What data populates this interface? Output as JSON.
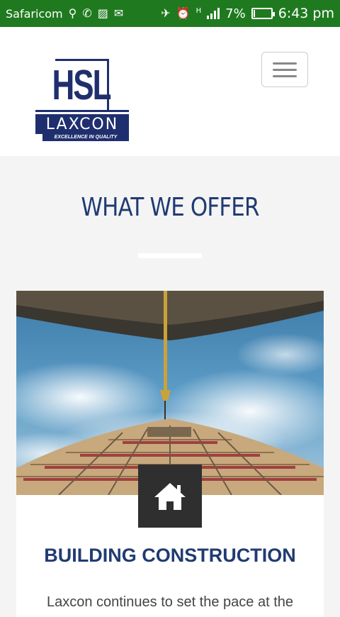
{
  "status_bar": {
    "carrier": "Safaricom",
    "network_type": "H",
    "battery": "7%",
    "battery_level": 0.07,
    "time": "6:43 pm"
  },
  "header": {
    "logo": {
      "mark": "HSL",
      "name": "LAXCON",
      "tagline": "EXCELLENCE IN QUALITY"
    },
    "menu_icon": "hamburger-icon"
  },
  "section": {
    "title": "WHAT WE OFFER"
  },
  "card": {
    "icon": "home-icon",
    "title": "BUILDING CONSTRUCTION",
    "text": "Laxcon continues to set the pace at the"
  },
  "colors": {
    "status_bar": "#1f7a1f",
    "brand_blue": "#213b72",
    "icon_box": "#2f2f2f",
    "background": "#f4f4f4"
  }
}
